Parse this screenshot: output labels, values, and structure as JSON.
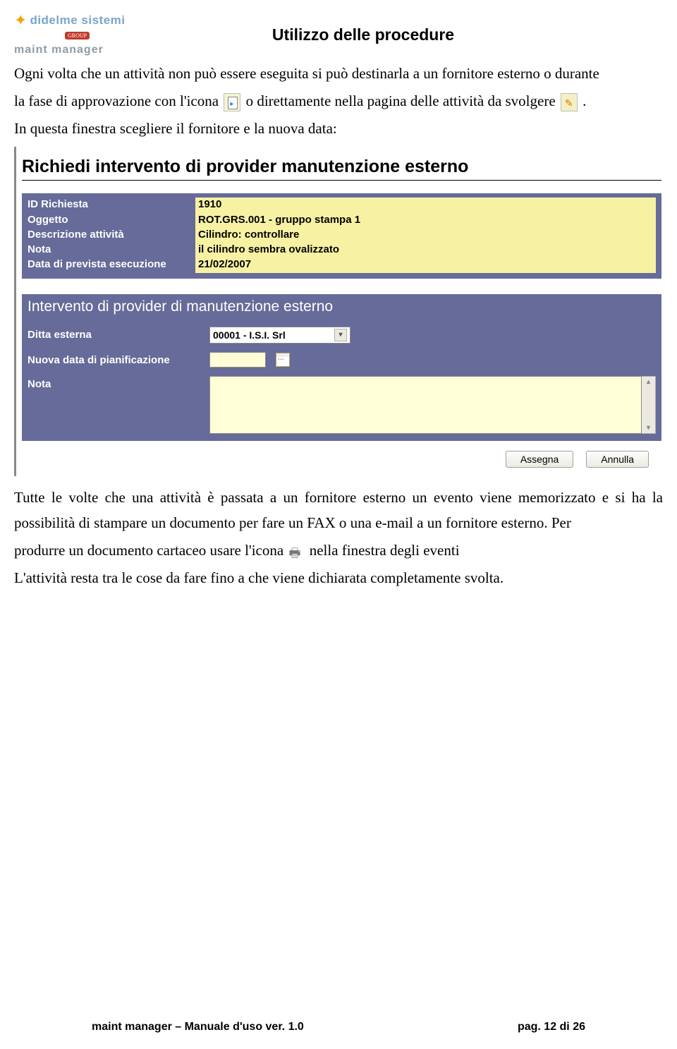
{
  "logo": {
    "company": "didelme sistemi",
    "group": "GROUP",
    "product": "maint manager"
  },
  "doc_title": "Utilizzo delle procedure",
  "para1": "Ogni volta che un attività non può essere eseguita si può destinarla a un fornitore esterno o durante",
  "para2a": "la fase di approvazione con l'icona ",
  "para2b": " o direttamente nella pagina delle attività da svolgere",
  "para2c": ".",
  "para3": "In questa finestra scegliere il fornitore e la nuova data:",
  "form": {
    "title": "Richiedi intervento di provider manutenzione esterno",
    "labels": {
      "id": "ID Richiesta",
      "oggetto": "Oggetto",
      "descr": "Descrizione attività",
      "nota": "Nota",
      "data_prev": "Data di prevista esecuzione"
    },
    "values": {
      "id": "1910",
      "oggetto": "ROT.GRS.001 - gruppo stampa 1",
      "descr": "Cilindro: controllare",
      "nota": "il cilindro sembra ovalizzato",
      "data_prev": "21/02/2007"
    },
    "section2": "Intervento di provider di manutenzione esterno",
    "f2labels": {
      "ditta": "Ditta esterna",
      "nuova_data": "Nuova data di pianificazione",
      "nota": "Nota"
    },
    "f2values": {
      "ditta": "00001 - I.S.I. Srl"
    },
    "buttons": {
      "assegna": "Assegna",
      "annulla": "Annulla"
    }
  },
  "para4": "Tutte le volte che una attività è passata a un fornitore esterno un evento viene memorizzato e si ha la possibilità di stampare un documento per fare un FAX o una e-mail a un fornitore esterno. Per",
  "para5a": "produrre un documento cartaceo usare l'icona ",
  "para5b": " nella finestra degli eventi",
  "para6": "L'attività resta tra le cose da fare fino a che viene dichiarata completamente svolta.",
  "footer": {
    "left": "maint manager – Manuale d'uso ver. 1.0",
    "right": "pag. 12 di 26"
  }
}
